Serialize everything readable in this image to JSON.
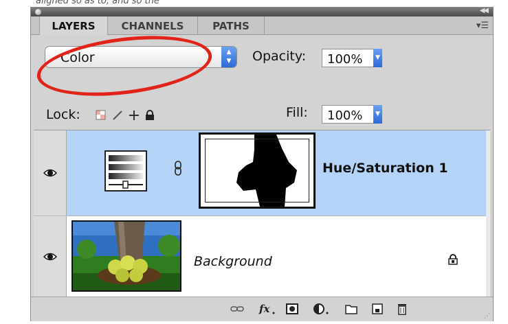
{
  "caption": "aligned so as to, and so the",
  "tabs": [
    {
      "label": "LAYERS",
      "active": true
    },
    {
      "label": "CHANNELS",
      "active": false
    },
    {
      "label": "PATHS",
      "active": false
    }
  ],
  "blend_mode": {
    "selected": "Color"
  },
  "opacity": {
    "label": "Opacity:",
    "value": "100%"
  },
  "lock": {
    "label": "Lock:"
  },
  "fill": {
    "label": "Fill:",
    "value": "100%"
  },
  "layers": [
    {
      "name": "Hue/Saturation 1",
      "type": "adjustment",
      "visible": true,
      "selected": true
    },
    {
      "name": "Background",
      "type": "image",
      "visible": true,
      "locked": true,
      "selected": false
    }
  ],
  "colors": {
    "selection": "#b5d3f7",
    "annotation": "#e2231a",
    "accent": "#2c6ad8"
  },
  "icons": {
    "lock": [
      "lock-transparent-icon",
      "lock-brush-icon",
      "lock-move-icon",
      "lock-all-icon"
    ],
    "bottom": [
      "link-layers-icon",
      "fx-icon",
      "add-mask-icon",
      "adjustment-layer-icon",
      "new-group-icon",
      "new-layer-icon",
      "trash-icon"
    ]
  }
}
